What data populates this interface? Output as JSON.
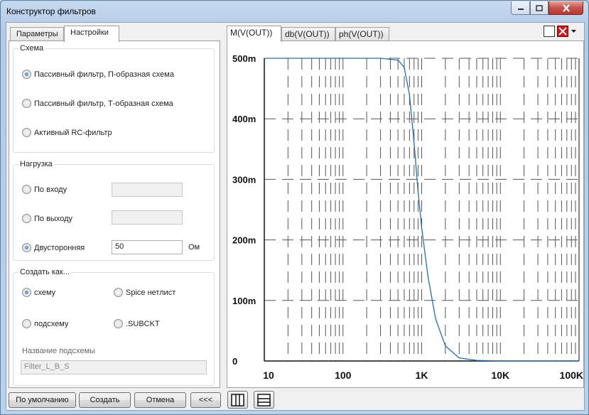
{
  "window": {
    "title": "Конструктор фильтров"
  },
  "left_tabs": [
    {
      "label": "Параметры"
    },
    {
      "label": "Настройки",
      "active": true
    }
  ],
  "scheme": {
    "title": "Схема",
    "options": [
      {
        "label": "Пассивный фильтр, П-образная схема",
        "checked": true
      },
      {
        "label": "Пассивный фильтр, Т-образная схема",
        "checked": false
      },
      {
        "label": "Активный RC-фильтр",
        "checked": false
      }
    ]
  },
  "load": {
    "title": "Нагрузка",
    "input": {
      "label": "По входу",
      "value": ""
    },
    "output": {
      "label": "По выходу",
      "value": ""
    },
    "both": {
      "label": "Двусторонняя",
      "value": "50",
      "unit": "Ом"
    }
  },
  "create_as": {
    "title": "Создать как...",
    "schema": "схему",
    "spice": "Spice нетлист",
    "subschema": "подсхему",
    "subckt": ".SUBCKT",
    "subschema_name_label": "Название подсхемы",
    "subschema_name_value": "Filter_L_B_S"
  },
  "buttons": {
    "default": "По умолчанию",
    "create": "Создать",
    "cancel": "Отмена",
    "collapse": "<<<"
  },
  "plot_tabs": [
    {
      "label": "M(V(OUT))",
      "active": true
    },
    {
      "label": "db(V(OUT))"
    },
    {
      "label": "ph(V(OUT))"
    }
  ],
  "colors": {
    "trace": "#1f6fbf",
    "grid": "#555555",
    "close_btn": "#c75050"
  },
  "chart_data": {
    "type": "line",
    "title": "",
    "xlabel": "",
    "ylabel": "",
    "xscale": "log",
    "xlim": [
      10,
      100000
    ],
    "ylim": [
      0,
      0.5
    ],
    "x_tick_labels": [
      "10",
      "100",
      "1K",
      "10K",
      "100K"
    ],
    "y_tick_labels": [
      "0",
      "100m",
      "200m",
      "300m",
      "400m",
      "500m"
    ],
    "grid": true,
    "series": [
      {
        "x": [
          10,
          100,
          300,
          500,
          600,
          700,
          800,
          900,
          1000,
          1200,
          1500,
          2000,
          3000,
          5000,
          10000,
          100000
        ],
        "y": [
          0.5,
          0.5,
          0.5,
          0.497,
          0.485,
          0.44,
          0.36,
          0.28,
          0.22,
          0.14,
          0.07,
          0.025,
          0.005,
          0.001,
          0,
          0
        ]
      }
    ]
  }
}
